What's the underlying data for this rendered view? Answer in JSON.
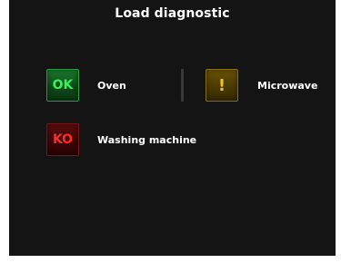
{
  "title": "Load diagnostic",
  "colors": {
    "background": "#141414",
    "ok": "#39f05a",
    "warning": "#f1c21b",
    "ko": "#ff2a2a",
    "text": "#ffffff"
  },
  "loads": [
    {
      "status": "ok",
      "status_text": "OK",
      "name": "Oven",
      "icon": "ok-status-icon"
    },
    {
      "status": "warning",
      "status_text": "!",
      "name": "Microwave",
      "icon": "warning-status-icon"
    },
    {
      "status": "ko",
      "status_text": "KO",
      "name": "Washing machine",
      "icon": "ko-status-icon"
    }
  ]
}
